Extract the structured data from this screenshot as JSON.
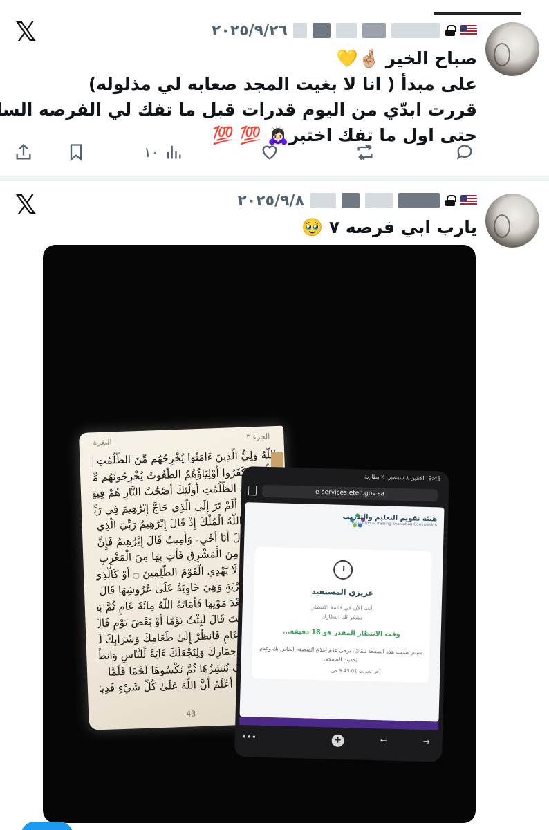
{
  "colors": {
    "text": "#0f1419",
    "secondary": "#536471",
    "divider": "#eff3f4",
    "accent": "#1d9bf0"
  },
  "posts": [
    {
      "logo_icon": "x-logo-icon",
      "logo_text": "𝕏",
      "date": "٢٠٢٥/٩/٢٦",
      "flag_icon": "us-flag-icon",
      "lock_icon": "lock-icon",
      "text_lines": [
        "صباح الخير 🤞🏼💛",
        "على مبدأ ( انا لا بغيت المجد صعابه لي مذلوله)",
        "قررت ابدّي من اليوم قدرات قبل ما تفك لي الفرصه السابعه",
        "حتى اول ما تفك اختبر🙇🏻‍♀️ 💯 💯"
      ],
      "actions": {
        "share_icon": "share-icon",
        "bookmark_icon": "bookmark-icon",
        "views_icon": "views-icon",
        "views_count": "١٠",
        "like_icon": "heart-icon",
        "repost_icon": "repost-icon",
        "reply_icon": "reply-icon"
      }
    },
    {
      "logo_icon": "x-logo-icon",
      "logo_text": "𝕏",
      "date": "٢٠٢٥/٩/٨",
      "flag_icon": "us-flag-icon",
      "lock_icon": "lock-icon",
      "text_lines": [
        "يارب ابي فرصه ٧ 🥹"
      ]
    }
  ],
  "photo": {
    "book": {
      "juz": "الجزء ٣",
      "surah": "البقرة",
      "page_number": "43",
      "verses": [
        "اللَّهُ وَلِيُّ الَّذِينَ ءَامَنُوا يُخْرِجُهُم مِّنَ الظُّلُمَٰتِ إِلَى النُّورِ",
        "وَالَّذِينَ كَفَرُوا أَوْلِيَاؤُهُمُ الطَّٰغُوتُ يُخْرِجُونَهُم مِّنَ",
        "النُّورِ إِلَى الظُّلُمَٰتِ أُولَٰئِكَ أَصْحَٰبُ النَّارِ هُمْ فِيهَا",
        "خَٰلِدُونَ ۝ أَلَمْ تَرَ إِلَى الَّذِي حَاجَّ إِبْرَٰهِيمَ فِي رَبِّهِ",
        "أَنْ ءَاتَىٰهُ اللَّهُ الْمُلْكَ إِذْ قَالَ إِبْرَٰهِيمُ رَبِّيَ الَّذِي يُحْيِۦ",
        "وَيُمِيتُ قَالَ أَنَا أُحْيِۦ وَأُمِيتُ قَالَ إِبْرَٰهِيمُ فَإِنَّ اللَّهَ يَأْتِي",
        "بِالشَّمْسِ مِنَ الْمَشْرِقِ فَأْتِ بِهَا مِنَ الْمَغْرِبِ فَبُهِتَ الَّذِي",
        "كَفَرَ وَاللَّهُ لَا يَهْدِي الْقَوْمَ الظَّٰلِمِينَ ۝ أَوْ كَالَّذِي",
        "مَرَّ عَلَىٰ قَرْيَةٍ وَهِيَ خَاوِيَةٌ عَلَىٰ عُرُوشِهَا قَالَ أَنَّىٰ يُحْيِۦ",
        "هَٰذِهِ اللَّهُ بَعْدَ مَوْتِهَا فَأَمَاتَهُ اللَّهُ مِائَةَ عَامٍ ثُمَّ بَعَثَهُ",
        "قَالَ كَمْ لَبِثْتَ قَالَ لَبِثْتُ يَوْمًا أَوْ بَعْضَ يَوْمٍ قَالَ بَل",
        "لَّبِثْتَ مِائَةَ عَامٍ فَانظُرْ إِلَىٰ طَعَامِكَ وَشَرَابِكَ لَمْ يَتَسَنَّهْ",
        "وَانظُرْ إِلَىٰ حِمَارِكَ وَلِنَجْعَلَكَ ءَايَةً لِّلنَّاسِ وَانظُرْ إِلَى",
        "الْعِظَامِ كَيْفَ نُنشِزُهَا ثُمَّ نَكْسُوهَا لَحْمًا فَلَمَّا",
        "تَبَيَّنَ لَهُ قَالَ أَعْلَمُ أَنَّ اللَّهَ عَلَىٰ كُلِّ شَيْءٍ قَدِيرٌ ۝"
      ]
    },
    "tablet": {
      "status_time": "9:45",
      "status_date": "الاثنين ٨ سبتمبر",
      "status_battery": "٪ بطارية",
      "url": "e-services.etec.gov.sa",
      "org_name_ar": "هيئة تقويم التعليم والتدريب",
      "org_name_en": "Education & Training Evaluation Commission",
      "greeting": "عزيزي المستفيد",
      "line1": "أنت الآن في قائمة الانتظار",
      "line2": "نشكر لك انتظارك",
      "wait_text": "وقت الانتظار المقدر هو 18 دقيقة...",
      "note": "سيتم تحديث هذه الصفحة تلقائيًا، يرجى عدم إغلاق المتصفح الخاص بك وعدم تحديث الصفحة.",
      "last_update": "آخر تحديث 9:43:01 ص",
      "nav_more": "•••",
      "nav_plus": "+",
      "nav_back": "←",
      "nav_forward": "→"
    }
  }
}
